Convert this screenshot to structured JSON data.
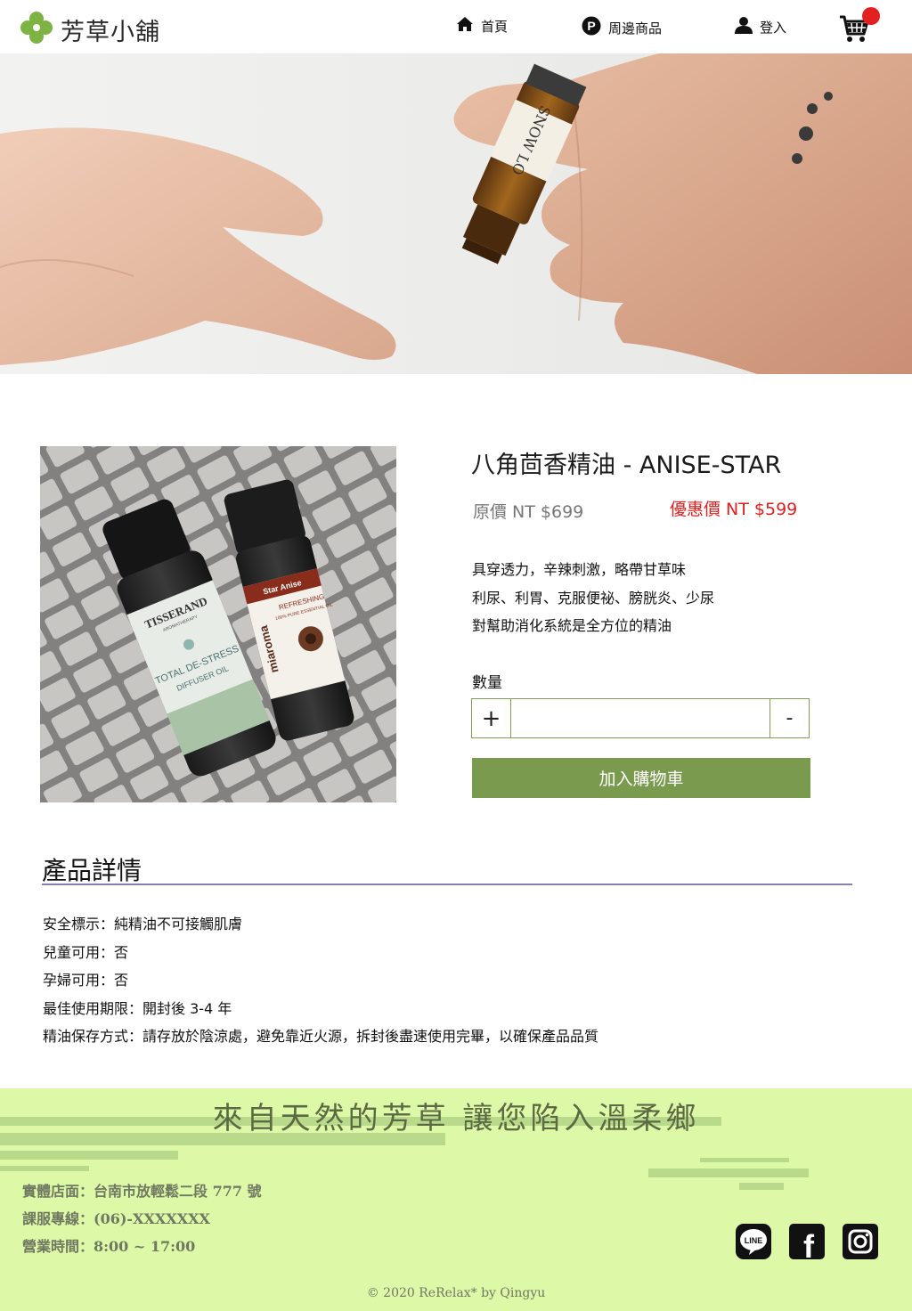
{
  "header": {
    "brand": "芳草小舖",
    "nav": [
      {
        "label": "首頁",
        "icon": "home-icon"
      },
      {
        "label": "周邊商品",
        "icon": "parking-p-icon"
      },
      {
        "label": "登入",
        "icon": "user-icon"
      }
    ],
    "cart_icon": "cart-icon",
    "cart_badge_color": "#e32020"
  },
  "product": {
    "title": "八角茴香精油 - ANISE-STAR",
    "original_price": "原價 NT $699",
    "sale_price": "優惠價 NT $599",
    "sale_color": "#e31e1e",
    "description": [
      "具穿透力，辛辣刺激，略帶甘草味",
      "利尿、利胃、克服便祕、膀胱炎、少尿",
      "對幫助消化系統是全方位的精油"
    ],
    "image_labels": {
      "bottle_left_brand": "TISSERAND",
      "bottle_left_sub": "AROMATHERAPY",
      "bottle_left_name": "TOTAL DE-STRESS",
      "bottle_left_type": "DIFFUSER OIL",
      "bottle_right_brand": "miaroma",
      "bottle_right_name": "Star Anise",
      "bottle_right_type": "REFRESHING",
      "bottle_right_sub": "100% PURE ESSENTIAL OIL"
    }
  },
  "hero": {
    "bottle_label": "SNOW LO"
  },
  "quantity": {
    "label": "數量",
    "plus": "+",
    "minus": "-",
    "value": ""
  },
  "add_to_cart": {
    "label": "加入購物車",
    "color": "#7a9b4e"
  },
  "details": {
    "title": "產品詳情",
    "items": [
      "安全標示：純精油不可接觸肌膚",
      "兒童可用：否",
      "孕婦可用：否",
      "最佳使用期限：開封後 3-4 年",
      "精油保存方式：請存放於陰涼處，避免靠近火源，拆封後盡速使用完畢，以確保產品品質"
    ]
  },
  "footer": {
    "background": "#ddf9a8",
    "slogan": "來自天然的芳草 讓您陷入溫柔鄉",
    "info": [
      "實體店面：台南市放輕鬆二段 777 號",
      "課服專線：(06)-XXXXXXX",
      "營業時間：8:00 ~ 17:00"
    ],
    "social": [
      {
        "icon": "line-icon",
        "label": "LINE"
      },
      {
        "icon": "facebook-icon",
        "label": "f"
      },
      {
        "icon": "instagram-icon",
        "label": ""
      }
    ],
    "copyright": "© 2020 ReRelax* by Qingyu"
  }
}
